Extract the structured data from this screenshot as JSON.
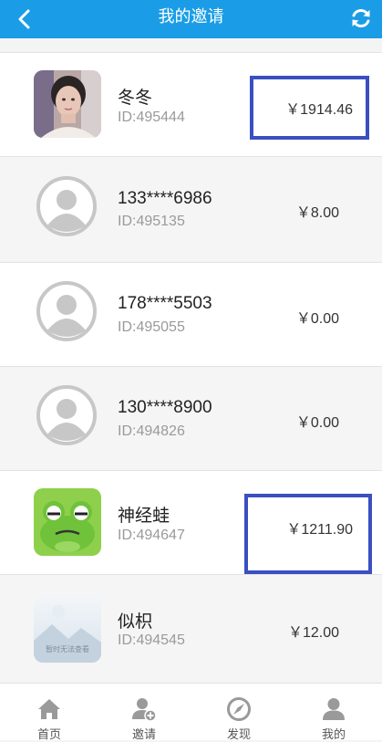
{
  "header": {
    "title": "我的邀请",
    "back_icon": "back-arrow-icon",
    "refresh_icon": "refresh-icon",
    "background": "#1a9de6"
  },
  "invites": [
    {
      "name": "冬冬",
      "id": "ID:495444",
      "amount": "￥1914.46",
      "avatar": "photo",
      "highlighted": true
    },
    {
      "name": "133****6986",
      "id": "ID:495135",
      "amount": "￥8.00",
      "avatar": "default-user",
      "highlighted": false
    },
    {
      "name": "178****5503",
      "id": "ID:495055",
      "amount": "￥0.00",
      "avatar": "default-user",
      "highlighted": false
    },
    {
      "name": "130****8900",
      "id": "ID:494826",
      "amount": "￥0.00",
      "avatar": "default-user",
      "highlighted": false
    },
    {
      "name": "神经蛙",
      "id": "ID:494647",
      "amount": "￥1211.90",
      "avatar": "frog",
      "highlighted": true
    },
    {
      "name": "似枳",
      "id": "ID:494545",
      "amount": "￥12.00",
      "avatar": "placeholder-image",
      "highlighted": false
    }
  ],
  "placeholder_caption": "暂时无法查看",
  "highlight_color": "#3a4fc0",
  "tabs": [
    {
      "label": "首页",
      "icon": "home-icon"
    },
    {
      "label": "邀请",
      "icon": "add-user-icon"
    },
    {
      "label": "发现",
      "icon": "compass-icon"
    },
    {
      "label": "我的",
      "icon": "user-icon"
    }
  ]
}
